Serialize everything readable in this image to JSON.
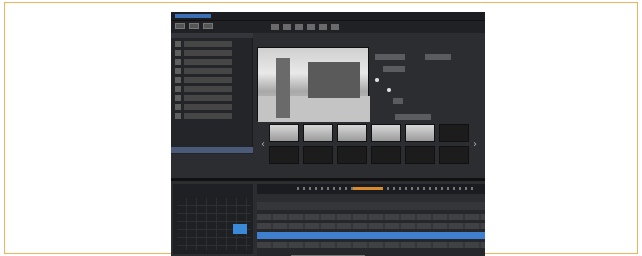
{
  "window": {
    "app_name": ""
  },
  "colors": {
    "frame_border": "#f2b25c",
    "app_bg": "#2b2d31",
    "selection_blue": "#3f7fd0",
    "timeline_marker": "#d98a2b"
  },
  "icons": [
    "play-icon",
    "pause-icon",
    "zoom-icon",
    "snapshot-icon",
    "layout-icon",
    "settings-icon",
    "prev-arrow-icon",
    "next-arrow-icon"
  ],
  "arrows": {
    "prev": "‹",
    "next": "›"
  }
}
